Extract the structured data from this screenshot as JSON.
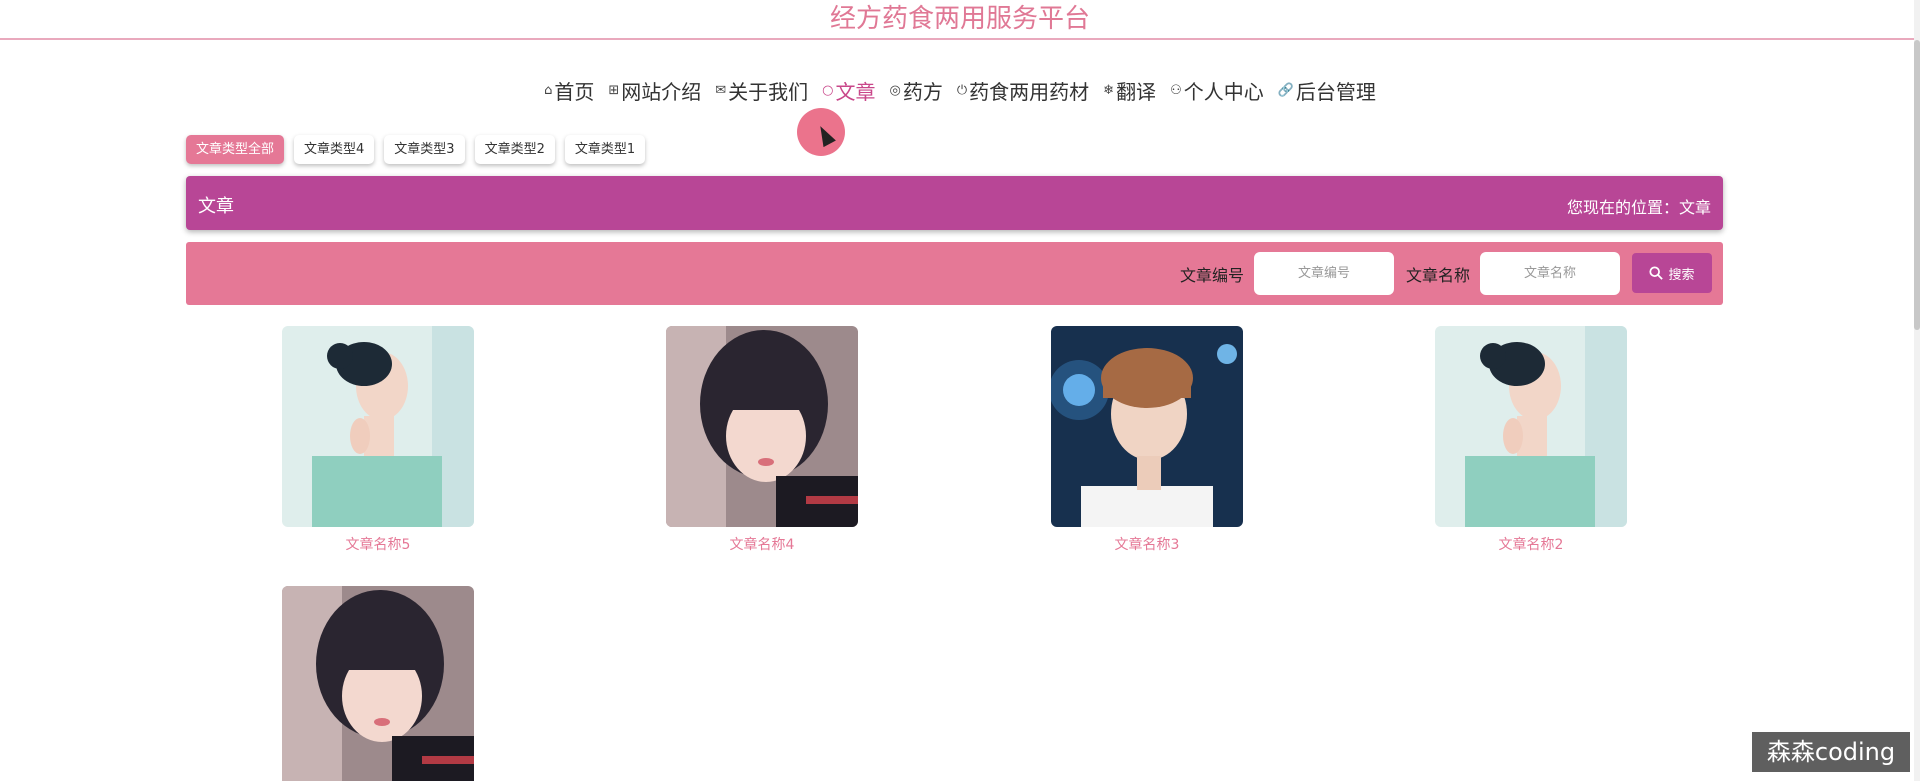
{
  "header": {
    "site_title": "经方药食两用服务平台"
  },
  "nav": {
    "items": [
      {
        "label": "首页",
        "icon": "home-icon",
        "glyph": "⌂"
      },
      {
        "label": "网站介绍",
        "icon": "grid-icon",
        "glyph": "⊞"
      },
      {
        "label": "关于我们",
        "icon": "mail-icon",
        "glyph": "✉"
      },
      {
        "label": "文章",
        "icon": "circle-icon",
        "glyph": "○"
      },
      {
        "label": "药方",
        "icon": "globe-icon",
        "glyph": "◎"
      },
      {
        "label": "药食两用药材",
        "icon": "power-icon",
        "glyph": "⏻"
      },
      {
        "label": "翻译",
        "icon": "snowflake-icon",
        "glyph": "❄"
      },
      {
        "label": "个人中心",
        "icon": "user-icon",
        "glyph": "⚇"
      },
      {
        "label": "后台管理",
        "icon": "link-icon",
        "glyph": "🔗"
      }
    ],
    "active_index": 3
  },
  "category_tabs": [
    "文章类型全部",
    "文章类型4",
    "文章类型3",
    "文章类型2",
    "文章类型1"
  ],
  "breadcrumb": {
    "title": "文章",
    "position": "您现在的位置：文章"
  },
  "search": {
    "field1_label": "文章编号",
    "field1_placeholder": "文章编号",
    "field2_label": "文章名称",
    "field2_placeholder": "文章名称",
    "button_label": "搜索"
  },
  "articles": [
    {
      "name": "文章名称5"
    },
    {
      "name": "文章名称4"
    },
    {
      "name": "文章名称3"
    },
    {
      "name": "文章名称2"
    },
    {
      "name": ""
    }
  ],
  "watermark": "森森coding",
  "colors": {
    "accent_pink": "#e57896",
    "accent_magenta": "#b84696",
    "title_pink": "#e07895"
  }
}
